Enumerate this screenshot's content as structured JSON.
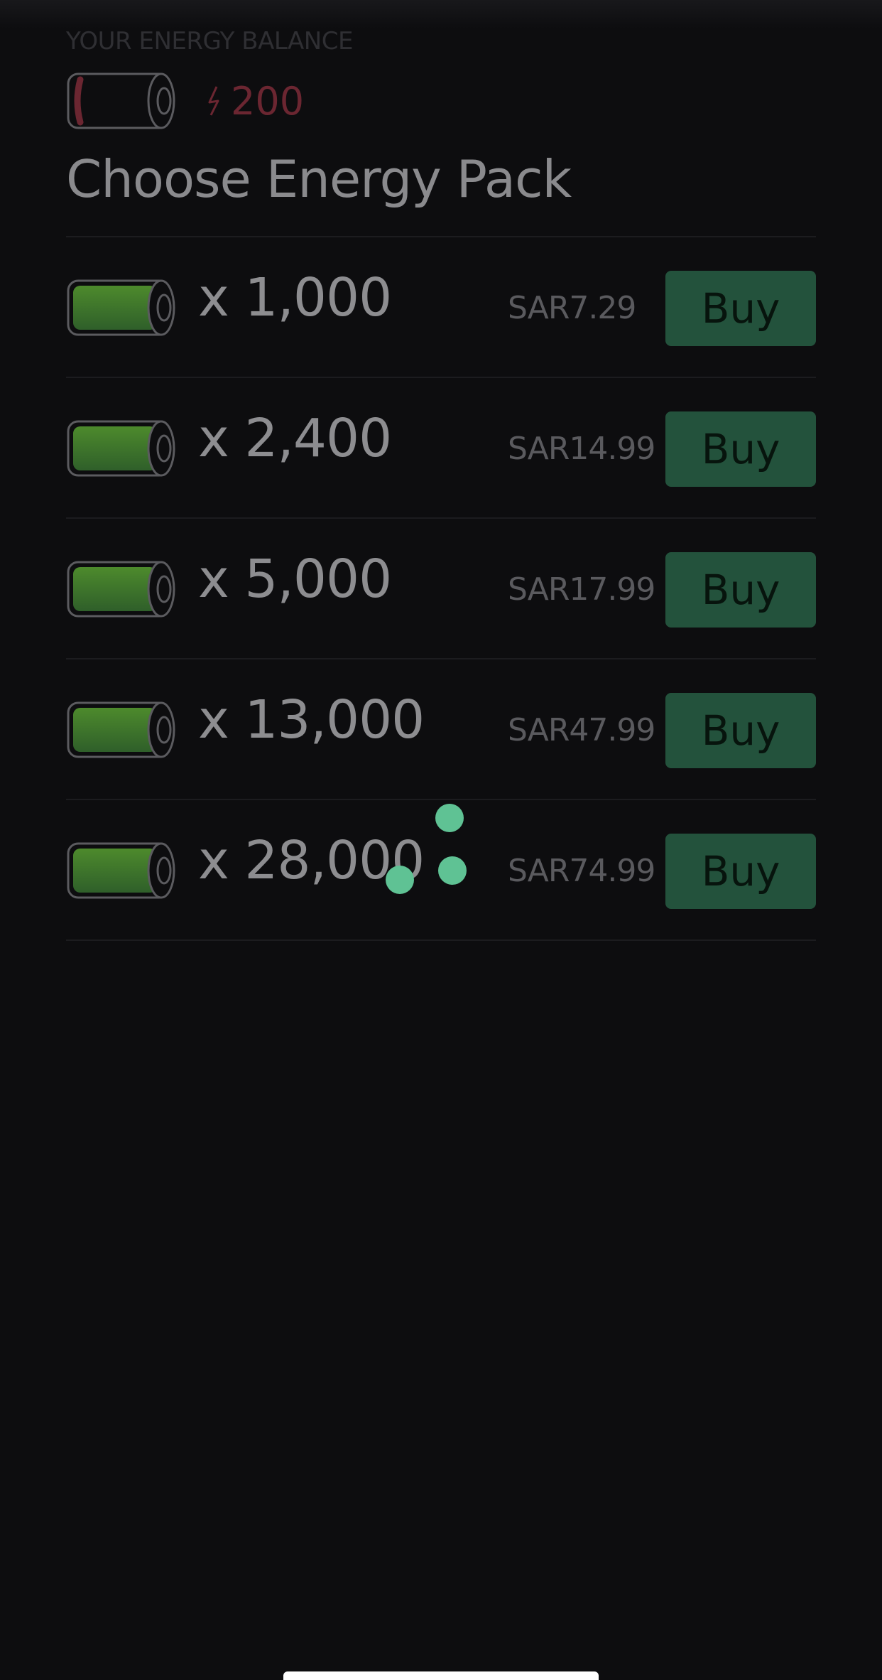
{
  "balance": {
    "caption": "YOUR ENERGY BALANCE",
    "value": "200",
    "battery_level": 0.05,
    "color": "#6b2631"
  },
  "title": "Choose Energy Pack",
  "packs": [
    {
      "amount": "x 1,000",
      "price": "SAR7.29",
      "buy_label": "Buy"
    },
    {
      "amount": "x 2,400",
      "price": "SAR14.99",
      "buy_label": "Buy"
    },
    {
      "amount": "x 5,000",
      "price": "SAR17.99",
      "buy_label": "Buy"
    },
    {
      "amount": "x 13,000",
      "price": "SAR47.99",
      "buy_label": "Buy"
    },
    {
      "amount": "x 28,000",
      "price": "SAR74.99",
      "buy_label": "Buy"
    }
  ],
  "colors": {
    "background": "#0d0d0f",
    "buy_button": "#23523c",
    "battery_fill": "#3f7a2e",
    "spinner": "#5fc294"
  },
  "icons": {
    "balance_battery": "battery-low-icon",
    "pack_battery": "battery-full-icon",
    "energy": "lightning-bolt-icon",
    "loading": "loading-spinner-icon"
  }
}
